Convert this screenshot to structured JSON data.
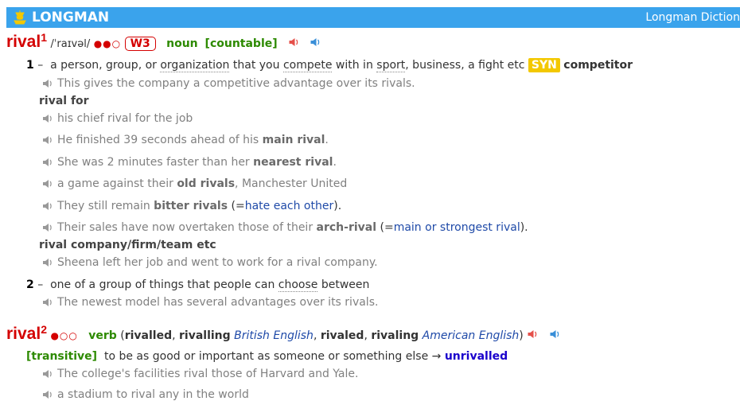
{
  "header": {
    "logo": "LONGMAN",
    "right": "Longman Diction"
  },
  "entry1": {
    "headword": "rival",
    "hom": "1",
    "pron": "/ˈraɪvəl/",
    "freq": "●●○",
    "w3": "W3",
    "pos": "noun",
    "gram": "[countable]",
    "sense1": {
      "num": "1",
      "dash": "–",
      "def_a": "a person, group, or ",
      "def_org": "organization",
      "def_b": " that you ",
      "def_compete": "compete",
      "def_c": " with in ",
      "def_sport": "sport",
      "def_d": ", business, a fight etc",
      "syn": "SYN",
      "syn_word": "competitor"
    },
    "ex1": "This gives the company a competitive advantage over its rivals.",
    "colloc1": "rival for",
    "ex2": "his chief rival for the job",
    "ex3_a": "He finished 39 seconds ahead of his ",
    "ex3_b": "main rival",
    "ex3_c": ".",
    "ex4_a": "She was 2 minutes faster than her ",
    "ex4_b": "nearest rival",
    "ex4_c": ".",
    "ex5_a": "a game against their ",
    "ex5_b": "old rivals",
    "ex5_c": ", Manchester United",
    "ex6_a": "They still remain ",
    "ex6_b": "bitter rivals",
    "ex6_c": " (=",
    "ex6_d": "hate each other",
    "ex6_e": ").",
    "ex7_a": "Their sales have now overtaken those of their ",
    "ex7_b": "arch-rival",
    "ex7_c": " (=",
    "ex7_d": "main or strongest rival",
    "ex7_e": ").",
    "colloc2": "rival company/firm/team etc",
    "ex8": "Sheena left her job and went to work for a rival company.",
    "sense2": {
      "num": "2",
      "dash": "–",
      "def_a": "one of a group of things that people can ",
      "def_choose": "choose",
      "def_b": " between"
    },
    "ex9": "The newest model has several advantages over its rivals."
  },
  "entry2": {
    "headword": "rival",
    "hom": "2",
    "freq": "●○○",
    "pos": "verb",
    "forms_a": "(",
    "f1": "rivalled",
    "f_sep": ", ",
    "f2": "rivalling",
    "reg1": "British English",
    "f3": "rivaled",
    "f4": "rivaling",
    "reg2": "American English",
    "forms_z": ")",
    "gram": "[transitive]",
    "def": "to be as good or important as someone or something else →",
    "xref": "unrivalled",
    "ex1": "The college's facilities rival those of Harvard and Yale.",
    "ex2": "a stadium to rival any in the world"
  },
  "colors": {
    "headword": "#d40000",
    "pos": "#2d8a00",
    "syn": "#f3c800",
    "bar": "#3aa3ec"
  }
}
